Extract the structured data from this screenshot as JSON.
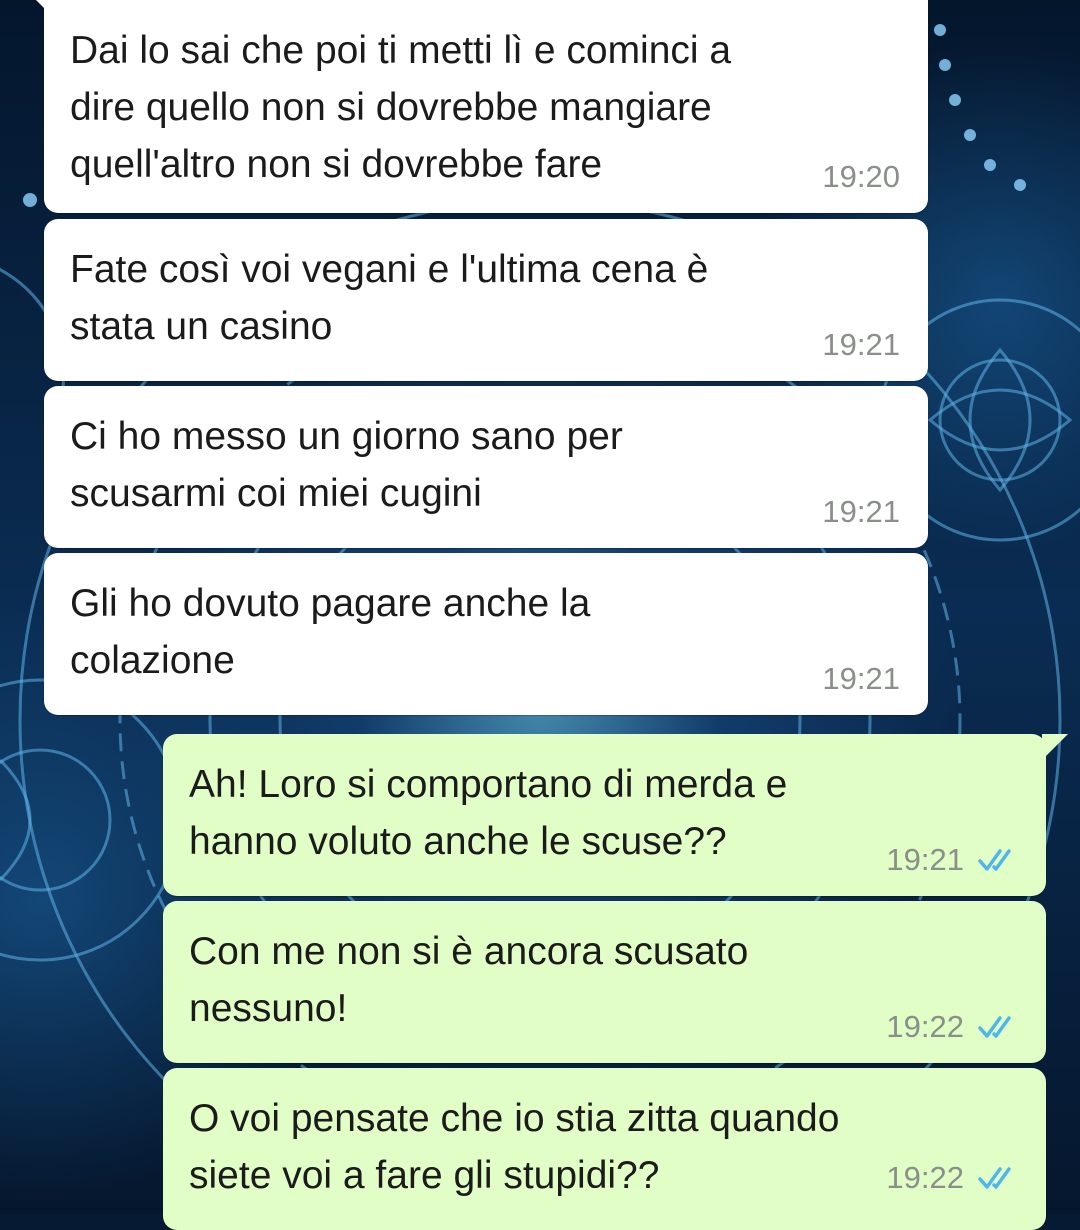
{
  "chat": {
    "messages": [
      {
        "direction": "incoming",
        "text": "Dai lo sai che poi ti metti lì e cominci a\ndire quello non si dovrebbe mangiare\nquell'altro non si dovrebbe fare",
        "time": "19:20"
      },
      {
        "direction": "incoming",
        "text": "Fate così voi vegani e l'ultima cena è\nstata un casino",
        "time": "19:21"
      },
      {
        "direction": "incoming",
        "text": "Ci ho messo un giorno sano per\nscusarmi coi miei cugini",
        "time": "19:21"
      },
      {
        "direction": "incoming",
        "text": "Gli ho dovuto pagare anche la\ncolazione",
        "time": "19:21"
      },
      {
        "direction": "outgoing",
        "text": "Ah! Loro si comportano di merda e\nhanno voluto anche le scuse??",
        "time": "19:21",
        "status": "read"
      },
      {
        "direction": "outgoing",
        "text": "Con me non si è ancora scusato\nnessuno!",
        "time": "19:22",
        "status": "read"
      },
      {
        "direction": "outgoing",
        "text": "O voi pensate che io stia zitta quando\nsiete voi a fare gli stupidi??",
        "time": "19:22",
        "status": "read"
      }
    ]
  },
  "colors": {
    "incoming_bubble": "#ffffff",
    "outgoing_bubble": "#e1fec6",
    "timestamp": "#8a8f8a",
    "read_ticks": "#4fb6ec",
    "wallpaper": "#061a33"
  },
  "icons": {
    "read_receipt": "double-check-icon"
  }
}
